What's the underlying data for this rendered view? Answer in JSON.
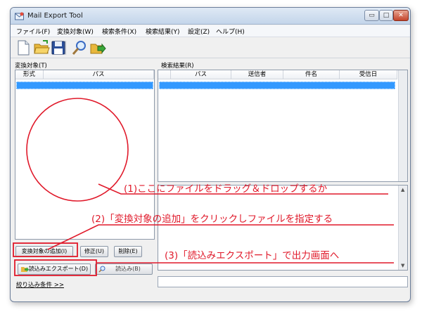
{
  "window": {
    "title": "Mail Export Tool",
    "min_glyph": "▭",
    "max_glyph": "□",
    "close_glyph": "✕"
  },
  "menu": [
    "ファイル(F)",
    "変換対象(W)",
    "検索条件(X)",
    "検索結果(Y)",
    "設定(Z)",
    "ヘルプ(H)"
  ],
  "toolbar_icons": [
    "new-file-icon",
    "open-folder-icon",
    "save-disk-icon",
    "search-magnifier-icon",
    "export-icon"
  ],
  "left_pane": {
    "label": "変換対象(T)",
    "columns": [
      "形式",
      "パス"
    ],
    "buttons": {
      "add": "変換対象の追加(I)",
      "edit": "修正(U)",
      "delete": "削除(E)"
    }
  },
  "right_pane": {
    "label": "検索結果(R)",
    "columns": [
      "パス",
      "送信者",
      "件名",
      "受信日"
    ]
  },
  "bottom": {
    "export_button": "読込みエクスポート(D)",
    "read_button": "読込み(B)",
    "filter_link": "絞り込み条件 >>"
  },
  "annotations": {
    "step1": "(1)ここにファイルをドラッグ＆ドロップするか",
    "step2": "(2)「変換対象の追加」をクリックしファイルを指定する",
    "step3": "(3)「読込みエクスポート」で出力画面へ"
  },
  "colors": {
    "annotation_red": "#e0192a",
    "selection_blue": "#3399ff"
  }
}
